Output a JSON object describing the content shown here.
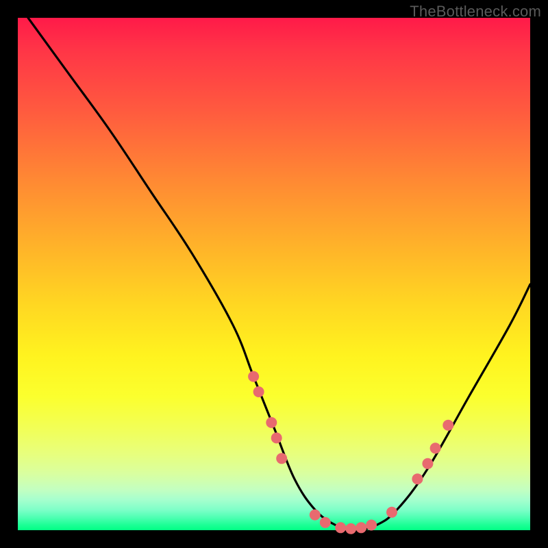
{
  "watermark": "TheBottleneck.com",
  "chart_data": {
    "type": "line",
    "title": "",
    "xlabel": "",
    "ylabel": "",
    "xlim": [
      0,
      100
    ],
    "ylim": [
      0,
      100
    ],
    "series": [
      {
        "name": "curve",
        "x": [
          2,
          10,
          18,
          26,
          34,
          42,
          46,
          50,
          54,
          58,
          62,
          66,
          70,
          74,
          80,
          88,
          96,
          100
        ],
        "values": [
          100,
          89,
          78,
          66,
          54,
          40,
          30,
          20,
          10,
          4,
          1,
          0,
          1,
          4,
          12,
          26,
          40,
          48
        ]
      }
    ],
    "markers": [
      {
        "x": 46.0,
        "y": 30.0
      },
      {
        "x": 47.0,
        "y": 27.0
      },
      {
        "x": 49.5,
        "y": 21.0
      },
      {
        "x": 50.5,
        "y": 18.0
      },
      {
        "x": 51.5,
        "y": 14.0
      },
      {
        "x": 58.0,
        "y": 3.0
      },
      {
        "x": 60.0,
        "y": 1.5
      },
      {
        "x": 63.0,
        "y": 0.5
      },
      {
        "x": 65.0,
        "y": 0.3
      },
      {
        "x": 67.0,
        "y": 0.5
      },
      {
        "x": 69.0,
        "y": 1.0
      },
      {
        "x": 73.0,
        "y": 3.5
      },
      {
        "x": 78.0,
        "y": 10.0
      },
      {
        "x": 80.0,
        "y": 13.0
      },
      {
        "x": 81.5,
        "y": 16.0
      },
      {
        "x": 84.0,
        "y": 20.5
      }
    ],
    "marker_color": "#e86a6f",
    "curve_color": "#000000"
  }
}
